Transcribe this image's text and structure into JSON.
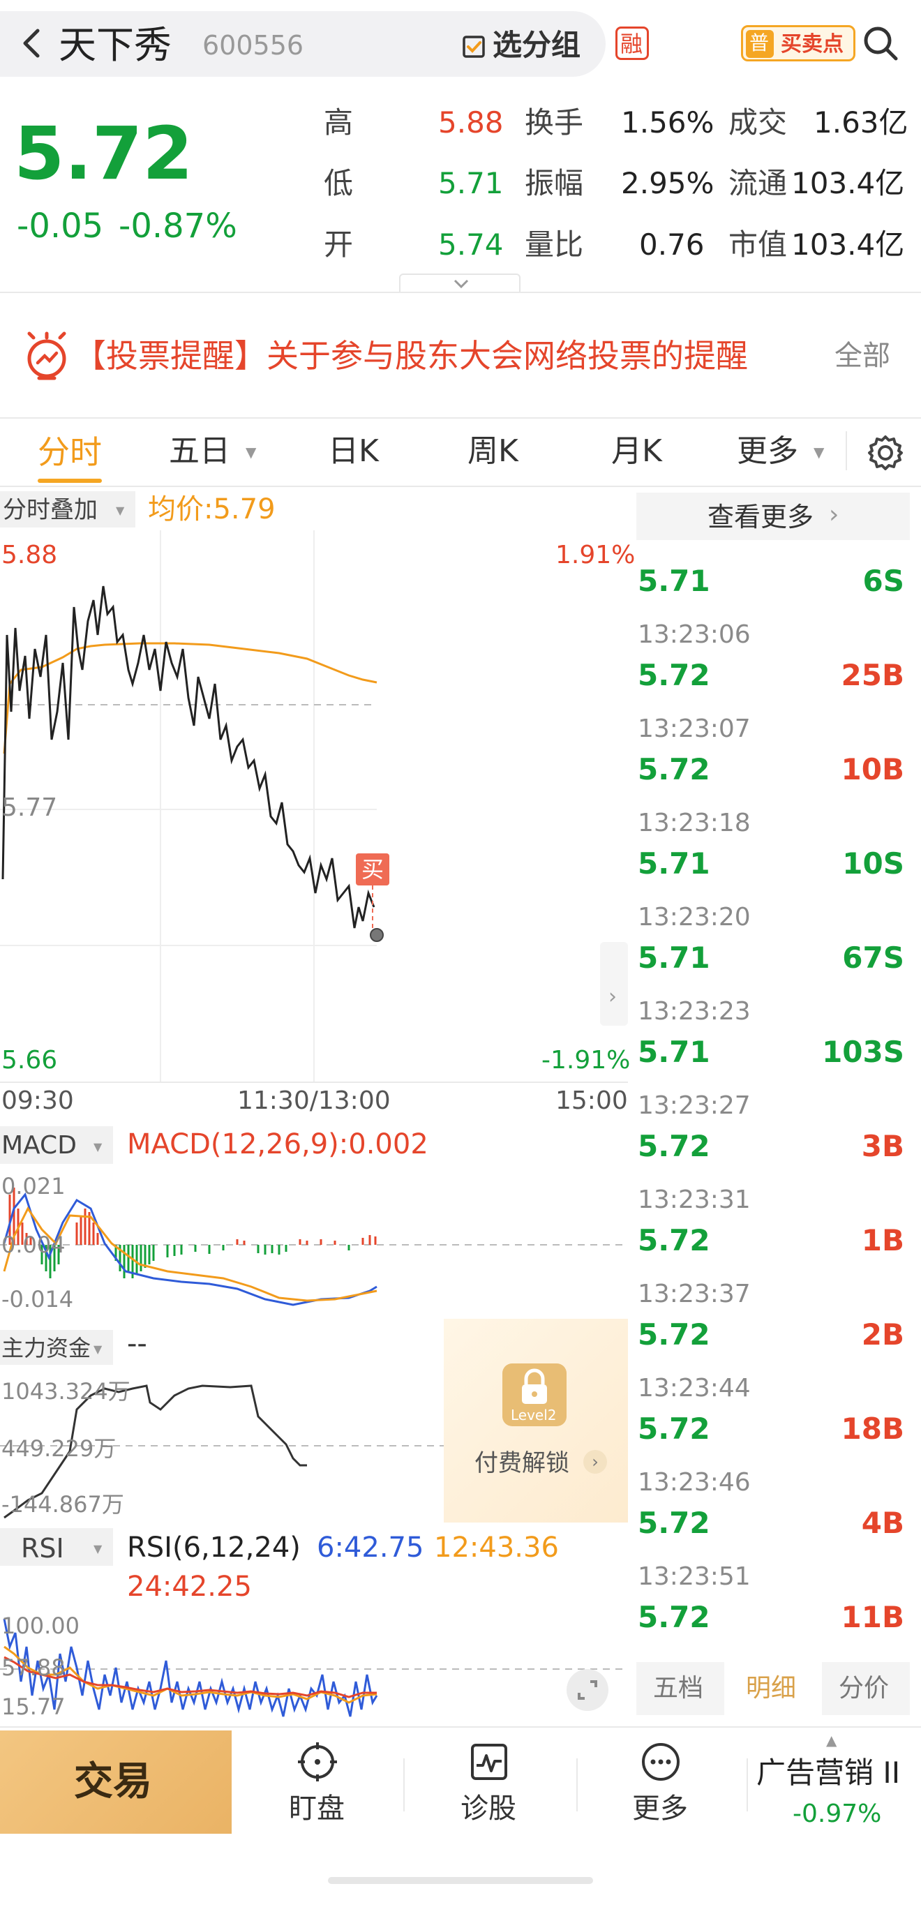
{
  "header": {
    "back_icon": "chevron-left-icon",
    "stock_name": "天下秀",
    "stock_code": "600556",
    "group_label": "选分组",
    "margin_badge": "融",
    "signal_badge_icon": "普",
    "signal_label": "买卖点",
    "search_icon": "search-icon"
  },
  "quote": {
    "price": "5.72",
    "change": "-0.05",
    "change_pct": "-0.87%",
    "stats": [
      {
        "label": "高",
        "value": "5.88",
        "color": "red"
      },
      {
        "label": "低",
        "value": "5.71",
        "color": "green"
      },
      {
        "label": "开",
        "value": "5.74",
        "color": "green"
      },
      {
        "label": "换手",
        "value": "1.56%"
      },
      {
        "label": "振幅",
        "value": "2.95%"
      },
      {
        "label": "量比",
        "value": "0.76"
      },
      {
        "label": "成交",
        "value": "1.63亿"
      },
      {
        "label": "流通",
        "value": "103.4亿"
      },
      {
        "label": "市值",
        "value": "103.4亿"
      }
    ]
  },
  "notice": {
    "text": "【投票提醒】关于参与股东大会网络投票的提醒",
    "all_label": "全部"
  },
  "tabs": [
    "分时",
    "五日",
    "日K",
    "周K",
    "月K",
    "更多"
  ],
  "chart_header": {
    "overlay_label": "分时叠加",
    "avg_label": "均价:5.79"
  },
  "price_chart": {
    "high_label": "5.88",
    "mid_label": "5.77",
    "low_label": "5.66",
    "pct_high": "1.91%",
    "pct_low": "-1.91%",
    "buy_marker": "买",
    "time_start": "09:30",
    "time_mid": "11:30/13:00",
    "time_end": "15:00"
  },
  "macd": {
    "selector": "MACD",
    "title": "MACD(12,26,9):0.002",
    "y_top": "0.021",
    "y_mid": "0.004",
    "y_bot": "-0.014"
  },
  "capital": {
    "selector": "主力资金",
    "value": "--",
    "y1": "1043.324万",
    "y2": "449.229万",
    "y3": "-144.867万",
    "lock_badge": "Level2",
    "unlock_label": "付费解锁"
  },
  "rsi": {
    "selector": "RSI",
    "title": "RSI(6,12,24)",
    "rsi6": "6:42.75",
    "rsi12": "12:43.36",
    "rsi24": "24:42.25",
    "y_top": "100.00",
    "y_mid": "57.88",
    "y_bot": "15.77"
  },
  "ticks": {
    "more_label": "查看更多",
    "rows": [
      {
        "time": "",
        "price": "5.71",
        "vol": "6S"
      },
      {
        "time": "13:23:06",
        "price": "5.72",
        "vol": "25B"
      },
      {
        "time": "13:23:07",
        "price": "5.72",
        "vol": "10B"
      },
      {
        "time": "13:23:18",
        "price": "5.71",
        "vol": "10S"
      },
      {
        "time": "13:23:20",
        "price": "5.71",
        "vol": "67S"
      },
      {
        "time": "13:23:23",
        "price": "5.71",
        "vol": "103S"
      },
      {
        "time": "13:23:27",
        "price": "5.72",
        "vol": "3B"
      },
      {
        "time": "13:23:31",
        "price": "5.72",
        "vol": "1B"
      },
      {
        "time": "13:23:37",
        "price": "5.72",
        "vol": "2B"
      },
      {
        "time": "13:23:44",
        "price": "5.72",
        "vol": "18B"
      },
      {
        "time": "13:23:46",
        "price": "5.72",
        "vol": "4B"
      },
      {
        "time": "13:23:51",
        "price": "5.72",
        "vol": "11B"
      }
    ],
    "tabs": [
      "五档",
      "明细",
      "分价"
    ]
  },
  "bottom": {
    "trade_label": "交易",
    "items": [
      "盯盘",
      "诊股",
      "更多"
    ],
    "sector_name": "广告营销 II",
    "sector_change": "-0.97%"
  },
  "colors": {
    "up": "#e5452b",
    "down": "#13a03a",
    "avg_line": "#f29b1b",
    "accent": "#f5a623"
  }
}
